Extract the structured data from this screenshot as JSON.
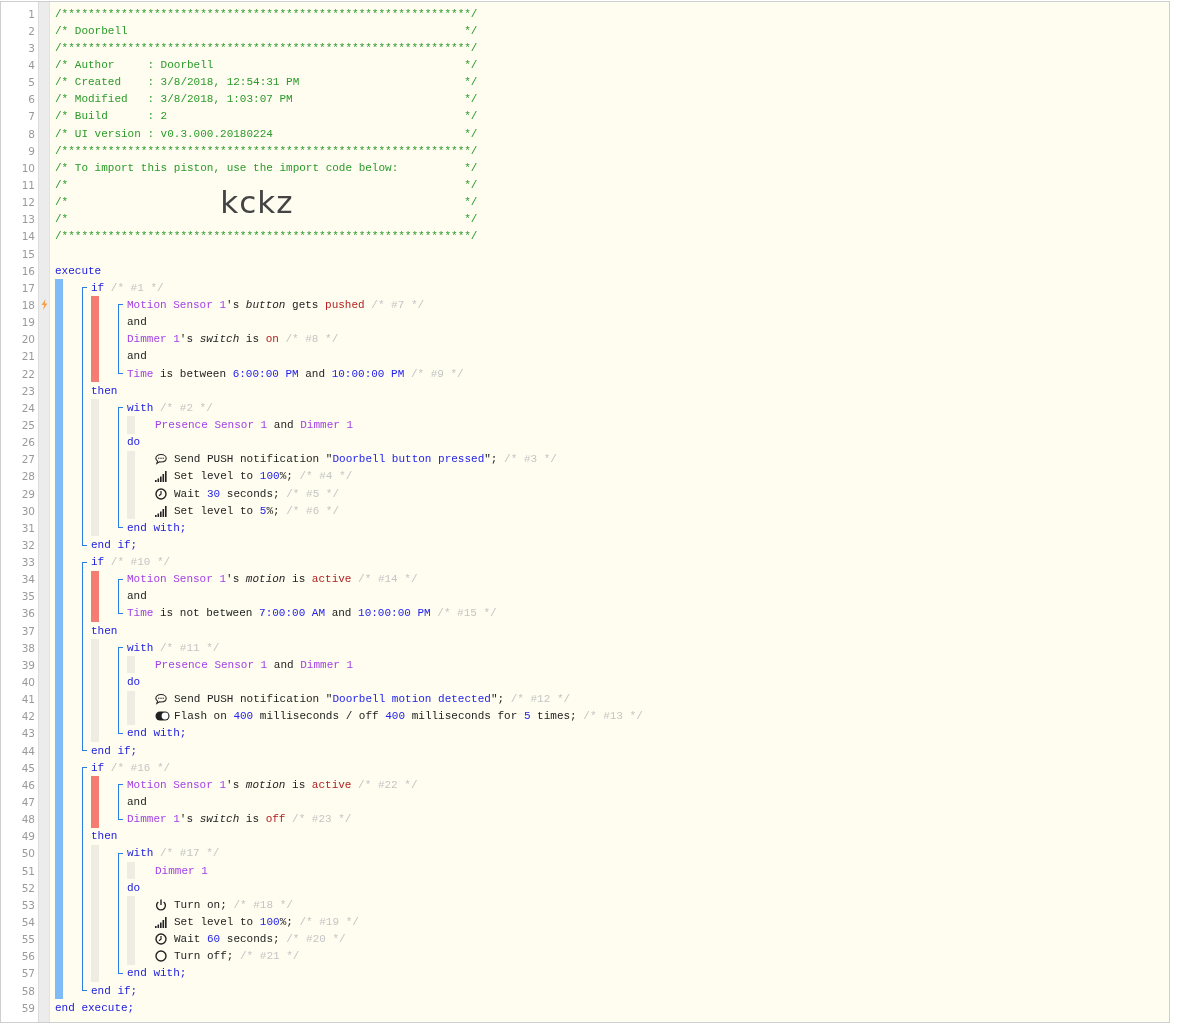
{
  "header": {
    "lines": [
      {
        "number": "1",
        "text": "/**************************************************************/"
      },
      {
        "number": "2",
        "text": "/* Doorbell",
        "end": "*/"
      },
      {
        "number": "3",
        "text": "/**************************************************************/"
      },
      {
        "number": "4",
        "text": "/* Author     : Doorbell",
        "end": "*/"
      },
      {
        "number": "5",
        "text": "/* Created    : 3/8/2018, 12:54:31 PM",
        "end": "*/"
      },
      {
        "number": "6",
        "text": "/* Modified   : 3/8/2018, 1:03:07 PM",
        "end": "*/"
      },
      {
        "number": "7",
        "text": "/* Build      : 2",
        "end": "*/"
      },
      {
        "number": "8",
        "text": "/* UI version : v0.3.000.20180224",
        "end": "*/"
      },
      {
        "number": "9",
        "text": "/**************************************************************/"
      },
      {
        "number": "10",
        "text": "/* To import this piston, use the import code below:",
        "end": "*/"
      },
      {
        "number": "11",
        "text": "/*",
        "end": "*/"
      },
      {
        "number": "12",
        "text": "/*",
        "import_code": "kckz",
        "end": "*/"
      },
      {
        "number": "13",
        "text": "/*",
        "end": "*/"
      },
      {
        "number": "14",
        "text": "/**************************************************************/"
      }
    ]
  },
  "blank_line": {
    "number": "15"
  },
  "piston": {
    "kind": "execute",
    "line": {
      "number": "16",
      "tokens": [
        {
          "kind": "keyword",
          "text": "execute"
        }
      ]
    },
    "body": [
      {
        "kind": "if",
        "line": {
          "number": "17",
          "tokens": [
            {
              "kind": "keyword",
              "text": "if "
            },
            {
              "kind": "comment",
              "text": "/* #1 */"
            }
          ]
        },
        "conditions": [
          {
            "number": "18",
            "trigger": true,
            "tokens": [
              {
                "kind": "device",
                "text": "Motion Sensor 1"
              },
              {
                "kind": "plain",
                "text": "'s "
              },
              {
                "kind": "attribute",
                "text": "button"
              },
              {
                "kind": "plain",
                "text": " gets "
              },
              {
                "kind": "state",
                "text": "pushed "
              },
              {
                "kind": "comment",
                "text": "/* #7 */"
              }
            ]
          },
          {
            "number": "19",
            "trigger": false,
            "tokens": [
              {
                "kind": "plain",
                "text": "and"
              }
            ]
          },
          {
            "number": "20",
            "trigger": false,
            "tokens": [
              {
                "kind": "device",
                "text": "Dimmer 1"
              },
              {
                "kind": "plain",
                "text": "'s "
              },
              {
                "kind": "attribute",
                "text": "switch"
              },
              {
                "kind": "plain",
                "text": " is "
              },
              {
                "kind": "state",
                "text": "on "
              },
              {
                "kind": "comment",
                "text": "/* #8 */"
              }
            ]
          },
          {
            "number": "21",
            "trigger": false,
            "tokens": [
              {
                "kind": "plain",
                "text": "and"
              }
            ]
          },
          {
            "number": "22",
            "trigger": false,
            "tokens": [
              {
                "kind": "device",
                "text": "Time"
              },
              {
                "kind": "plain",
                "text": " is between "
              },
              {
                "kind": "value",
                "text": "6:00:00 PM"
              },
              {
                "kind": "plain",
                "text": " and "
              },
              {
                "kind": "value",
                "text": "10:00:00 PM "
              },
              {
                "kind": "comment",
                "text": "/* #9 */"
              }
            ]
          }
        ],
        "then": {
          "number": "23",
          "tokens": [
            {
              "kind": "keyword",
              "text": "then"
            }
          ]
        },
        "body": [
          {
            "kind": "with",
            "line": {
              "number": "24",
              "tokens": [
                {
                  "kind": "keyword",
                  "text": "with "
                },
                {
                  "kind": "comment",
                  "text": "/* #2 */"
                }
              ]
            },
            "devices": [
              {
                "number": "25",
                "tokens": [
                  {
                    "kind": "device",
                    "text": "Presence Sensor 1"
                  },
                  {
                    "kind": "plain",
                    "text": " and "
                  },
                  {
                    "kind": "device",
                    "text": "Dimmer 1"
                  }
                ]
              }
            ],
            "do": {
              "number": "26",
              "tokens": [
                {
                  "kind": "keyword",
                  "text": "do"
                }
              ]
            },
            "actions": [
              {
                "number": "27",
                "kind": "notify",
                "tokens": [
                  {
                    "kind": "plain",
                    "text": "Send PUSH notification \""
                  },
                  {
                    "kind": "value",
                    "text": "Doorbell button pressed"
                  },
                  {
                    "kind": "plain",
                    "text": "\"; "
                  },
                  {
                    "kind": "comment",
                    "text": "/* #3 */"
                  }
                ]
              },
              {
                "number": "28",
                "kind": "level",
                "tokens": [
                  {
                    "kind": "plain",
                    "text": "Set level to "
                  },
                  {
                    "kind": "value",
                    "text": "100"
                  },
                  {
                    "kind": "plain",
                    "text": "%; "
                  },
                  {
                    "kind": "comment",
                    "text": "/* #4 */"
                  }
                ]
              },
              {
                "number": "29",
                "kind": "wait",
                "tokens": [
                  {
                    "kind": "plain",
                    "text": "Wait "
                  },
                  {
                    "kind": "value",
                    "text": "30"
                  },
                  {
                    "kind": "plain",
                    "text": " seconds; "
                  },
                  {
                    "kind": "comment",
                    "text": "/* #5 */"
                  }
                ]
              },
              {
                "number": "30",
                "kind": "level",
                "tokens": [
                  {
                    "kind": "plain",
                    "text": "Set level to "
                  },
                  {
                    "kind": "value",
                    "text": "5"
                  },
                  {
                    "kind": "plain",
                    "text": "%; "
                  },
                  {
                    "kind": "comment",
                    "text": "/* #6 */"
                  }
                ]
              }
            ],
            "end": {
              "number": "31",
              "tokens": [
                {
                  "kind": "keyword",
                  "text": "end with;"
                }
              ]
            }
          }
        ],
        "end": {
          "number": "32",
          "tokens": [
            {
              "kind": "keyword",
              "text": "end if;"
            }
          ]
        }
      },
      {
        "kind": "if",
        "line": {
          "number": "33",
          "tokens": [
            {
              "kind": "keyword",
              "text": "if "
            },
            {
              "kind": "comment",
              "text": "/* #10 */"
            }
          ]
        },
        "conditions": [
          {
            "number": "34",
            "trigger": false,
            "tokens": [
              {
                "kind": "device",
                "text": "Motion Sensor 1"
              },
              {
                "kind": "plain",
                "text": "'s "
              },
              {
                "kind": "attribute",
                "text": "motion"
              },
              {
                "kind": "plain",
                "text": " is "
              },
              {
                "kind": "state",
                "text": "active "
              },
              {
                "kind": "comment",
                "text": "/* #14 */"
              }
            ]
          },
          {
            "number": "35",
            "trigger": false,
            "tokens": [
              {
                "kind": "plain",
                "text": "and"
              }
            ]
          },
          {
            "number": "36",
            "trigger": false,
            "tokens": [
              {
                "kind": "device",
                "text": "Time"
              },
              {
                "kind": "plain",
                "text": " is not between "
              },
              {
                "kind": "value",
                "text": "7:00:00 AM"
              },
              {
                "kind": "plain",
                "text": " and "
              },
              {
                "kind": "value",
                "text": "10:00:00 PM "
              },
              {
                "kind": "comment",
                "text": "/* #15 */"
              }
            ]
          }
        ],
        "then": {
          "number": "37",
          "tokens": [
            {
              "kind": "keyword",
              "text": "then"
            }
          ]
        },
        "body": [
          {
            "kind": "with",
            "line": {
              "number": "38",
              "tokens": [
                {
                  "kind": "keyword",
                  "text": "with "
                },
                {
                  "kind": "comment",
                  "text": "/* #11 */"
                }
              ]
            },
            "devices": [
              {
                "number": "39",
                "tokens": [
                  {
                    "kind": "device",
                    "text": "Presence Sensor 1"
                  },
                  {
                    "kind": "plain",
                    "text": " and "
                  },
                  {
                    "kind": "device",
                    "text": "Dimmer 1"
                  }
                ]
              }
            ],
            "do": {
              "number": "40",
              "tokens": [
                {
                  "kind": "keyword",
                  "text": "do"
                }
              ]
            },
            "actions": [
              {
                "number": "41",
                "kind": "notify",
                "tokens": [
                  {
                    "kind": "plain",
                    "text": "Send PUSH notification \""
                  },
                  {
                    "kind": "value",
                    "text": "Doorbell motion detected"
                  },
                  {
                    "kind": "plain",
                    "text": "\"; "
                  },
                  {
                    "kind": "comment",
                    "text": "/* #12 */"
                  }
                ]
              },
              {
                "number": "42",
                "kind": "flash",
                "tokens": [
                  {
                    "kind": "plain",
                    "text": "Flash on "
                  },
                  {
                    "kind": "value",
                    "text": "400"
                  },
                  {
                    "kind": "plain",
                    "text": " milliseconds / off "
                  },
                  {
                    "kind": "value",
                    "text": "400"
                  },
                  {
                    "kind": "plain",
                    "text": " milliseconds for "
                  },
                  {
                    "kind": "value",
                    "text": "5"
                  },
                  {
                    "kind": "plain",
                    "text": " times; "
                  },
                  {
                    "kind": "comment",
                    "text": "/* #13 */"
                  }
                ]
              }
            ],
            "end": {
              "number": "43",
              "tokens": [
                {
                  "kind": "keyword",
                  "text": "end with;"
                }
              ]
            }
          }
        ],
        "end": {
          "number": "44",
          "tokens": [
            {
              "kind": "keyword",
              "text": "end if;"
            }
          ]
        }
      },
      {
        "kind": "if",
        "line": {
          "number": "45",
          "tokens": [
            {
              "kind": "keyword",
              "text": "if "
            },
            {
              "kind": "comment",
              "text": "/* #16 */"
            }
          ]
        },
        "conditions": [
          {
            "number": "46",
            "trigger": false,
            "tokens": [
              {
                "kind": "device",
                "text": "Motion Sensor 1"
              },
              {
                "kind": "plain",
                "text": "'s "
              },
              {
                "kind": "attribute",
                "text": "motion"
              },
              {
                "kind": "plain",
                "text": " is "
              },
              {
                "kind": "state",
                "text": "active "
              },
              {
                "kind": "comment",
                "text": "/* #22 */"
              }
            ]
          },
          {
            "number": "47",
            "trigger": false,
            "tokens": [
              {
                "kind": "plain",
                "text": "and"
              }
            ]
          },
          {
            "number": "48",
            "trigger": false,
            "tokens": [
              {
                "kind": "device",
                "text": "Dimmer 1"
              },
              {
                "kind": "plain",
                "text": "'s "
              },
              {
                "kind": "attribute",
                "text": "switch"
              },
              {
                "kind": "plain",
                "text": " is "
              },
              {
                "kind": "state",
                "text": "off "
              },
              {
                "kind": "comment",
                "text": "/* #23 */"
              }
            ]
          }
        ],
        "then": {
          "number": "49",
          "tokens": [
            {
              "kind": "keyword",
              "text": "then"
            }
          ]
        },
        "body": [
          {
            "kind": "with",
            "line": {
              "number": "50",
              "tokens": [
                {
                  "kind": "keyword",
                  "text": "with "
                },
                {
                  "kind": "comment",
                  "text": "/* #17 */"
                }
              ]
            },
            "devices": [
              {
                "number": "51",
                "tokens": [
                  {
                    "kind": "device",
                    "text": "Dimmer 1"
                  }
                ]
              }
            ],
            "do": {
              "number": "52",
              "tokens": [
                {
                  "kind": "keyword",
                  "text": "do"
                }
              ]
            },
            "actions": [
              {
                "number": "53",
                "kind": "on",
                "tokens": [
                  {
                    "kind": "plain",
                    "text": "Turn on; "
                  },
                  {
                    "kind": "comment",
                    "text": "/* #18 */"
                  }
                ]
              },
              {
                "number": "54",
                "kind": "level",
                "tokens": [
                  {
                    "kind": "plain",
                    "text": "Set level to "
                  },
                  {
                    "kind": "value",
                    "text": "100"
                  },
                  {
                    "kind": "plain",
                    "text": "%; "
                  },
                  {
                    "kind": "comment",
                    "text": "/* #19 */"
                  }
                ]
              },
              {
                "number": "55",
                "kind": "wait",
                "tokens": [
                  {
                    "kind": "plain",
                    "text": "Wait "
                  },
                  {
                    "kind": "value",
                    "text": "60"
                  },
                  {
                    "kind": "plain",
                    "text": " seconds; "
                  },
                  {
                    "kind": "comment",
                    "text": "/* #20 */"
                  }
                ]
              },
              {
                "number": "56",
                "kind": "off",
                "tokens": [
                  {
                    "kind": "plain",
                    "text": "Turn off; "
                  },
                  {
                    "kind": "comment",
                    "text": "/* #21 */"
                  }
                ]
              }
            ],
            "end": {
              "number": "57",
              "tokens": [
                {
                  "kind": "keyword",
                  "text": "end with;"
                }
              ]
            }
          }
        ],
        "end": {
          "number": "58",
          "tokens": [
            {
              "kind": "keyword",
              "text": "end if;"
            }
          ]
        }
      }
    ],
    "end": {
      "number": "59",
      "tokens": [
        {
          "kind": "keyword",
          "text": "end execute;"
        }
      ]
    }
  }
}
